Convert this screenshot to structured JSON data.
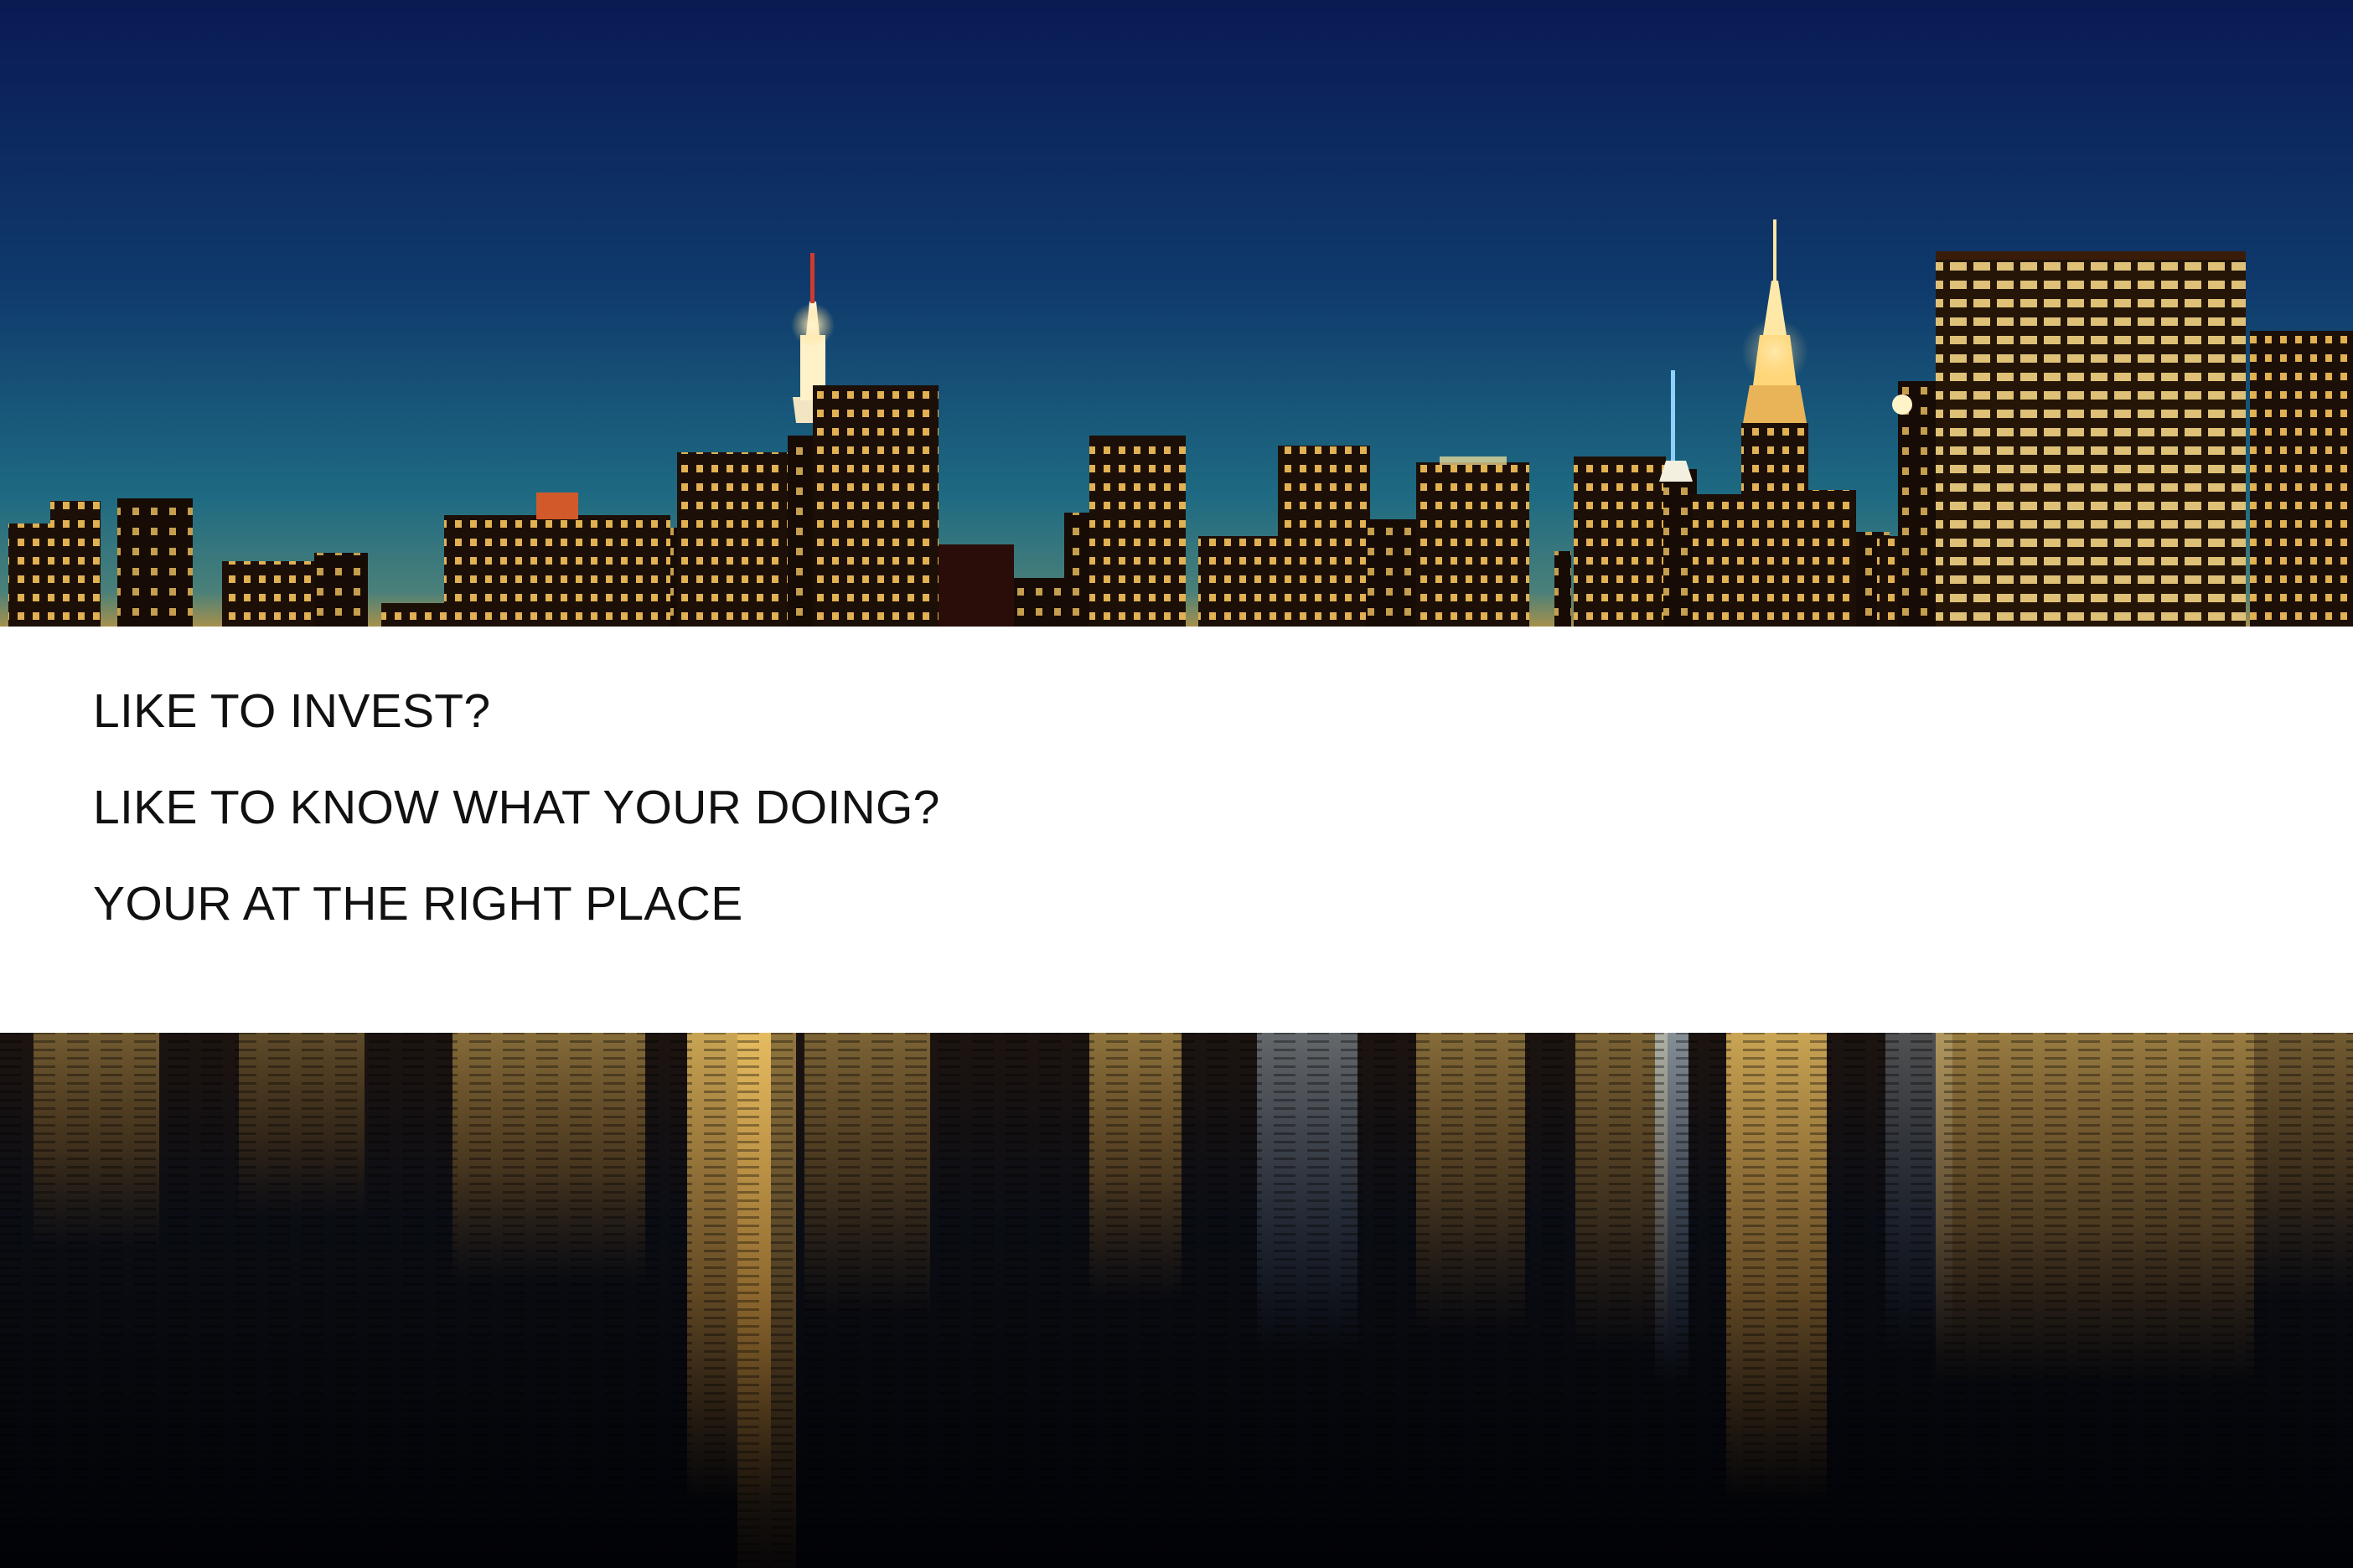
{
  "photo": {
    "subject": "night-city-skyline-with-water-reflection"
  },
  "colors": {
    "sky_top": "#0a1a4e",
    "sky_mid": "#0f3e6e",
    "sky_horizon": "#2c6d7c",
    "horizon_glow": "#c89a3a",
    "building_dark": "#1a0e08",
    "window_light": "#ffd36a",
    "water_dark": "#020409",
    "band_background": "#ffffff",
    "text_color": "#111111"
  },
  "message": {
    "lines": [
      "LIKE TO INVEST?",
      "LIKE TO KNOW WHAT YOUR DOING?",
      "YOUR AT THE RIGHT PLACE"
    ]
  }
}
